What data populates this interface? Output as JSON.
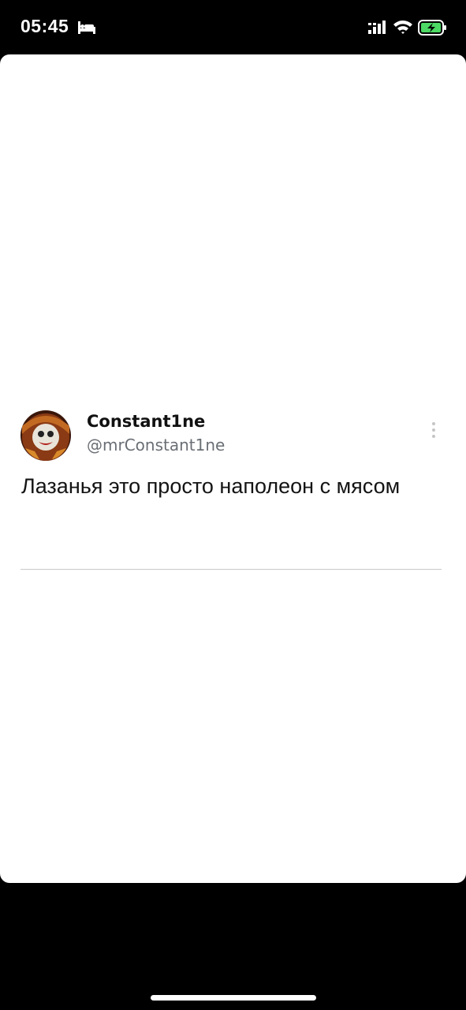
{
  "status_bar": {
    "time": "05:45",
    "icons": [
      "sleep-icon",
      "cellular-signal-icon",
      "wifi-icon",
      "battery-charging-icon"
    ],
    "battery_color": "#4cd964"
  },
  "tweet": {
    "display_name": "Constant1ne",
    "handle": "@mrConstant1ne",
    "text": "Лазанья это просто наполеон с мясом",
    "avatar": "avatar-image",
    "menu_icon": "more-vertical-icon"
  },
  "colors": {
    "background": "#000000",
    "card": "#ffffff",
    "handle": "#6a6f75",
    "divider": "#c9c9c9"
  }
}
